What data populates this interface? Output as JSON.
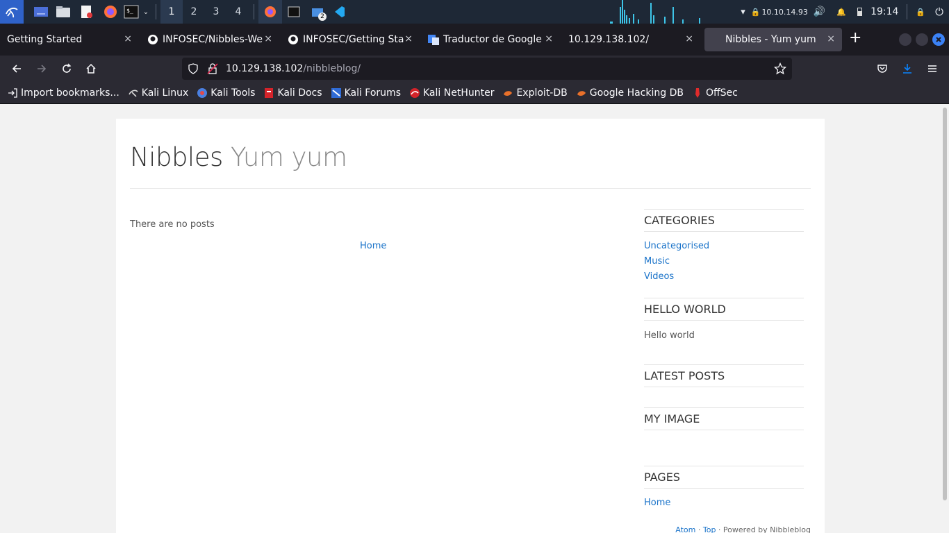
{
  "panel": {
    "workspaces": [
      "1",
      "2",
      "3",
      "4"
    ],
    "active_workspace": "1",
    "ip": "10.10.14.93",
    "clock": "19:14",
    "notif_badge": "2"
  },
  "tabs": [
    {
      "title": "Getting Started",
      "icon": "kali-dragon-icon"
    },
    {
      "title": "INFOSEC/Nibbles-We",
      "icon": "github-icon"
    },
    {
      "title": "INFOSEC/Getting Star",
      "icon": "github-icon"
    },
    {
      "title": "Traductor de Google",
      "icon": "google-translate-icon"
    },
    {
      "title": "10.129.138.102/",
      "icon": ""
    },
    {
      "title": "Nibbles - Yum yum",
      "icon": ""
    }
  ],
  "close_glyph": "×",
  "url": {
    "host": "10.129.138.102",
    "path": "/nibbleblog/"
  },
  "bookmarks": [
    {
      "label": "Import bookmarks...",
      "icon": "import-icon"
    },
    {
      "label": "Kali Linux",
      "icon": "kali-icon"
    },
    {
      "label": "Kali Tools",
      "icon": "kali-tools-icon"
    },
    {
      "label": "Kali Docs",
      "icon": "kali-docs-icon"
    },
    {
      "label": "Kali Forums",
      "icon": "kali-forums-icon"
    },
    {
      "label": "Kali NetHunter",
      "icon": "nethunter-icon"
    },
    {
      "label": "Exploit-DB",
      "icon": "exploitdb-icon"
    },
    {
      "label": "Google Hacking DB",
      "icon": "ghdb-icon"
    },
    {
      "label": "OffSec",
      "icon": "offsec-icon"
    }
  ],
  "blog": {
    "name": "Nibbles",
    "slogan": "Yum yum",
    "no_posts": "There are no posts",
    "home_link": "Home",
    "sidebar": {
      "categories_title": "CATEGORIES",
      "categories": [
        "Uncategorised",
        "Music",
        "Videos"
      ],
      "hello_title": "HELLO WORLD",
      "hello_text": "Hello world",
      "latest_title": "LATEST POSTS",
      "image_title": "MY IMAGE",
      "pages_title": "PAGES",
      "pages": [
        "Home"
      ]
    },
    "footer": {
      "atom": "Atom",
      "sep1": " · ",
      "top": "Top",
      "sep2": " · ",
      "powered": "Powered by Nibbleblog"
    }
  },
  "colors": {
    "panel_bg": "#1e2836",
    "tabbar_bg": "#1c1b22",
    "toolbar_bg": "#2b2a33",
    "link": "#1a73c9",
    "accent_blue": "#0a84ff"
  }
}
